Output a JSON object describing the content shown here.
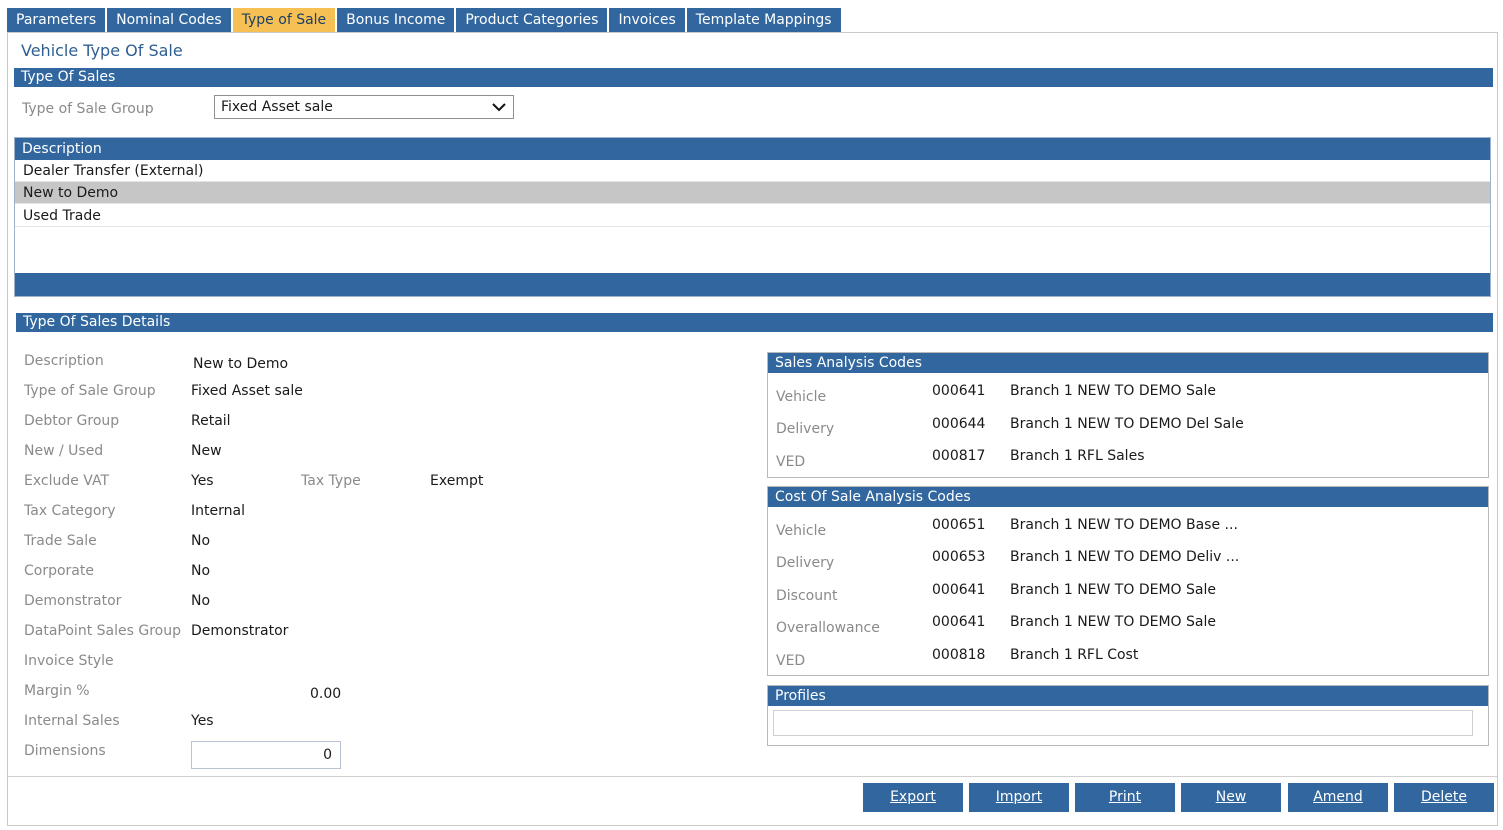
{
  "tabs": [
    "Parameters",
    "Nominal Codes",
    "Type of Sale",
    "Bonus Income",
    "Product Categories",
    "Invoices",
    "Template Mappings"
  ],
  "active_tab": "Type of Sale",
  "page_title": "Vehicle Type Of Sale",
  "type_of_sales": {
    "header": "Type Of Sales",
    "group_label": "Type of Sale Group",
    "group_value": "Fixed Asset sale"
  },
  "description_list": {
    "header": "Description",
    "rows": [
      "Dealer Transfer (External)",
      "New to Demo",
      "Used Trade"
    ],
    "selected": "New to Demo"
  },
  "details": {
    "header": "Type Of Sales Details",
    "description": {
      "label": "Description",
      "value": "New to Demo"
    },
    "type_of_sale_group": {
      "label": "Type of Sale Group",
      "value": "Fixed Asset sale"
    },
    "debtor_group": {
      "label": "Debtor Group",
      "value": "Retail"
    },
    "new_used": {
      "label": "New / Used",
      "value": "New"
    },
    "exclude_vat": {
      "label": "Exclude VAT",
      "value": "Yes"
    },
    "tax_type": {
      "label": "Tax Type",
      "value": "Exempt"
    },
    "tax_category": {
      "label": "Tax Category",
      "value": "Internal"
    },
    "trade_sale": {
      "label": "Trade Sale",
      "value": "No"
    },
    "corporate": {
      "label": "Corporate",
      "value": "No"
    },
    "demonstrator": {
      "label": "Demonstrator",
      "value": "No"
    },
    "datapoint_sales_group": {
      "label": "DataPoint Sales Group",
      "value": "Demonstrator"
    },
    "invoice_style": {
      "label": "Invoice Style",
      "value": ""
    },
    "margin": {
      "label": "Margin %",
      "value": "0.00"
    },
    "internal_sales": {
      "label": "Internal Sales",
      "value": "Yes"
    },
    "dimensions": {
      "label": "Dimensions",
      "value": "0"
    }
  },
  "sales_analysis": {
    "header": "Sales Analysis Codes",
    "rows": [
      {
        "label": "Vehicle",
        "code": "000641",
        "desc": "Branch 1 NEW TO DEMO Sale"
      },
      {
        "label": "Delivery",
        "code": "000644",
        "desc": "Branch 1 NEW TO DEMO Del Sale"
      },
      {
        "label": "VED",
        "code": "000817",
        "desc": "Branch 1 RFL Sales"
      }
    ]
  },
  "cost_analysis": {
    "header": "Cost Of Sale Analysis Codes",
    "rows": [
      {
        "label": "Vehicle",
        "code": "000651",
        "desc": "Branch 1 NEW TO DEMO Base ..."
      },
      {
        "label": "Delivery",
        "code": "000653",
        "desc": "Branch 1 NEW TO DEMO Deliv ..."
      },
      {
        "label": "Discount",
        "code": "000641",
        "desc": "Branch 1 NEW TO DEMO Sale"
      },
      {
        "label": "Overallowance",
        "code": "000641",
        "desc": "Branch 1 NEW TO DEMO Sale"
      },
      {
        "label": "VED",
        "code": "000818",
        "desc": "Branch 1 RFL Cost"
      }
    ]
  },
  "profiles": {
    "header": "Profiles"
  },
  "buttons": [
    "Export",
    "Import",
    "Print",
    "New",
    "Amend",
    "Delete"
  ],
  "colors": {
    "accent": "#31679e",
    "active_tab": "#f6c055",
    "selected_row": "#c6c6c6"
  }
}
